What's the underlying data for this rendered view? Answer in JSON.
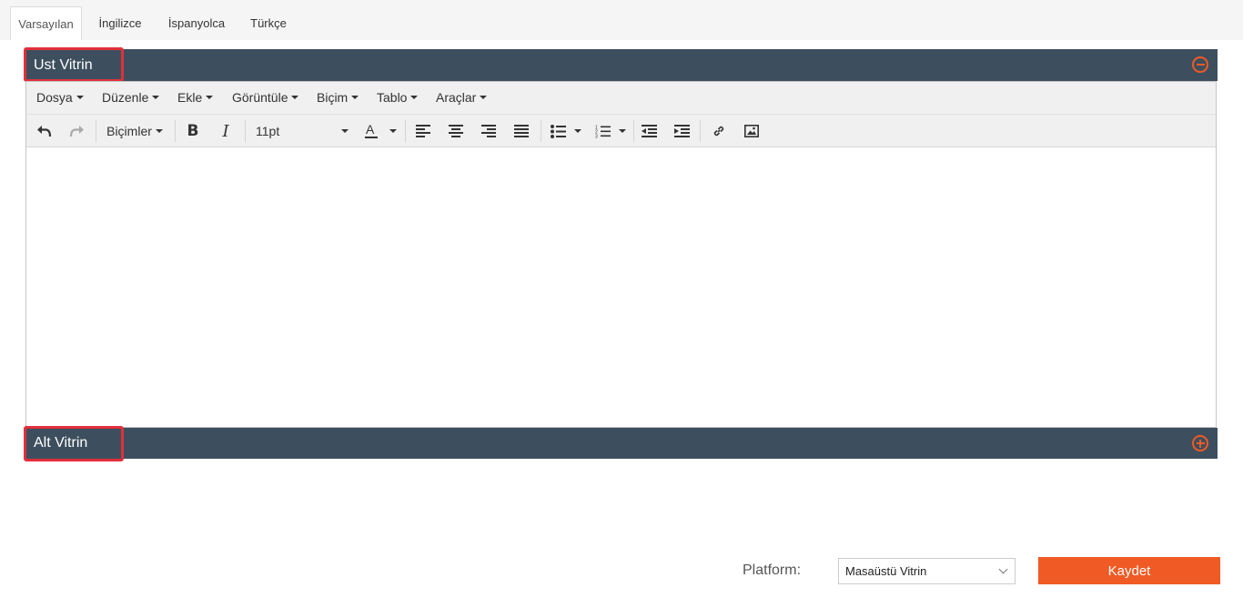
{
  "tabs": [
    "Varsayılan",
    "İngilizce",
    "İspanyolca",
    "Türkçe"
  ],
  "sections": {
    "top": {
      "title": "Ust Vitrin",
      "toggle_icon": "minus-circle-icon"
    },
    "bottom": {
      "title": "Alt Vitrin",
      "toggle_icon": "plus-circle-icon"
    }
  },
  "editor": {
    "menus": [
      "Dosya",
      "Düzenle",
      "Ekle",
      "Görüntüle",
      "Biçim",
      "Tablo",
      "Araçlar"
    ],
    "formats_label": "Biçimler",
    "font_size": "11pt",
    "icons": [
      "undo-icon",
      "redo-icon",
      "bold-icon",
      "italic-icon",
      "text-color-icon",
      "align-left-icon",
      "align-center-icon",
      "align-right-icon",
      "align-justify-icon",
      "bullet-list-icon",
      "numbered-list-icon",
      "outdent-icon",
      "indent-icon",
      "link-icon",
      "image-icon"
    ]
  },
  "footer": {
    "platform_label": "Platform:",
    "platform_value": "Masaüstü Vitrin",
    "save_label": "Kaydet"
  },
  "colors": {
    "bar": "#3d4f5e",
    "accent": "#f05a24",
    "highlight": "#e0303b"
  }
}
